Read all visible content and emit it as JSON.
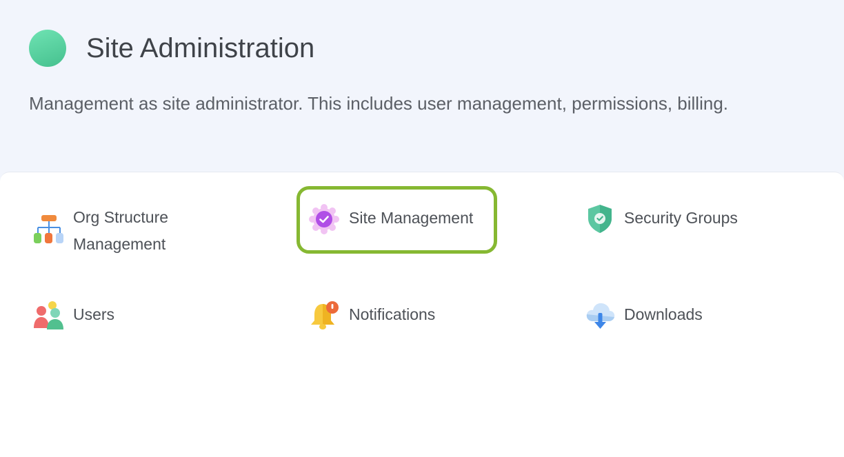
{
  "header": {
    "title": "Site Administration",
    "description": "Management as site administrator. This includes user management, permissions, billing."
  },
  "menu": {
    "items": [
      {
        "label_line1": "Org Structure",
        "label_line2": "Management",
        "icon": "org-chart-icon"
      },
      {
        "label": "Site Management",
        "icon": "badge-check-icon"
      },
      {
        "label": "Security Groups",
        "icon": "shield-icon"
      },
      {
        "label": "Users",
        "icon": "users-icon"
      },
      {
        "label": "Notifications",
        "icon": "bell-icon"
      },
      {
        "label": "Downloads",
        "icon": "cloud-download-icon"
      }
    ]
  },
  "colors": {
    "highlight": "#86b832",
    "logo": "#4fd09b",
    "header_bg": "#f2f5fc"
  }
}
